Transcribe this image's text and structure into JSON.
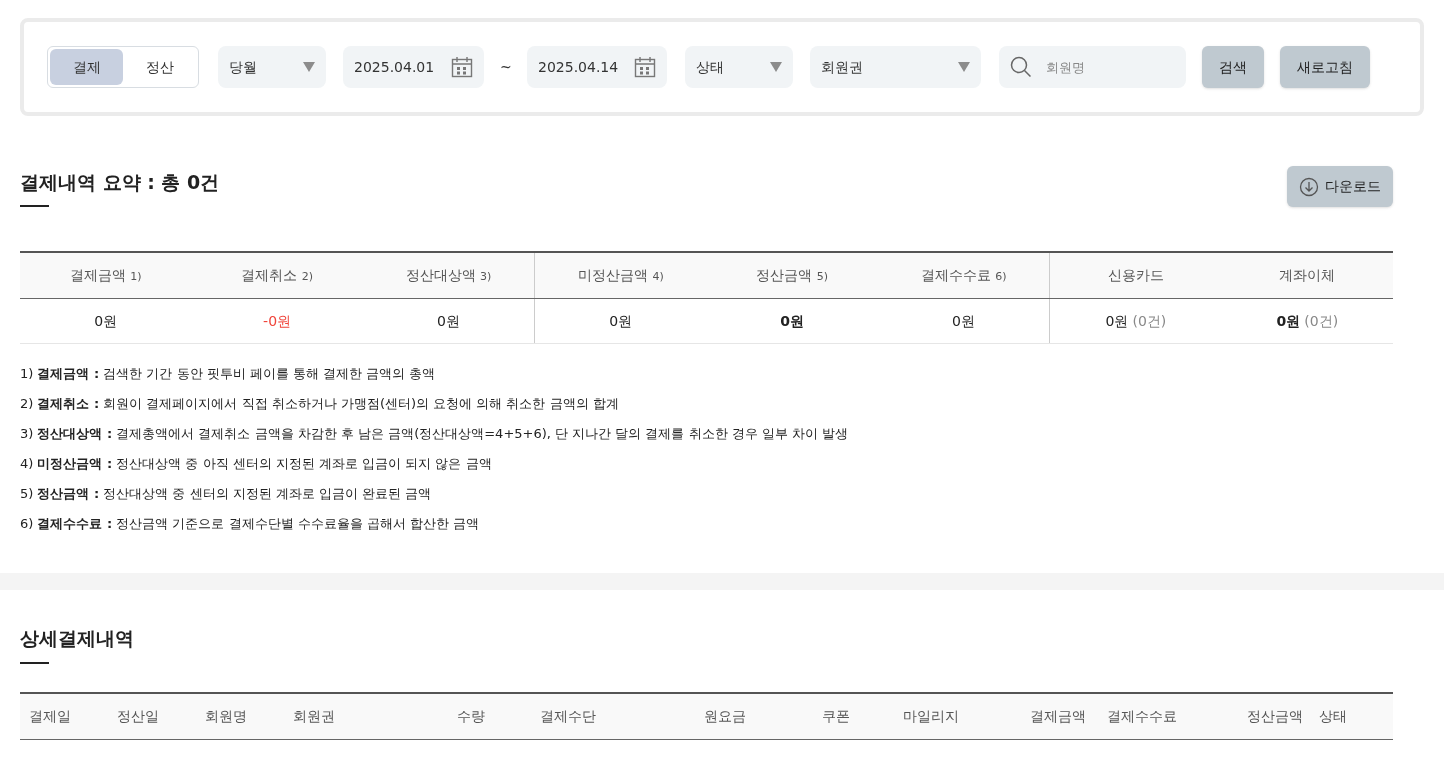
{
  "filter": {
    "mode_tabs": [
      {
        "label": "결제",
        "selected": true
      },
      {
        "label": "정산",
        "selected": false
      }
    ],
    "period_select": {
      "value": "당월"
    },
    "date_from": {
      "value": "2025.04.01"
    },
    "range_separator": "~",
    "date_to": {
      "value": "2025.04.14"
    },
    "status_select": {
      "value": "상태"
    },
    "membership_select": {
      "value": "회원권"
    },
    "search": {
      "placeholder": "회원명"
    },
    "buttons": [
      "검색",
      "새로고침"
    ]
  },
  "summary": {
    "title": "결제내역 요약 : 총 0건",
    "download_button": "다운로드",
    "columns": [
      {
        "label": "결제금액",
        "note": "1)",
        "value": "0원",
        "kind": "normal"
      },
      {
        "label": "결제취소",
        "note": "2)",
        "value": "-0원",
        "kind": "negative"
      },
      {
        "label": "정산대상액",
        "note": "3)",
        "value": "0원",
        "kind": "normal"
      },
      {
        "label": "미정산금액",
        "note": "4)",
        "value": "0원",
        "kind": "normal"
      },
      {
        "label": "정산금액",
        "note": "5)",
        "value": "0원",
        "kind": "bold"
      },
      {
        "label": "결제수수료",
        "note": "6)",
        "value": "0원",
        "kind": "normal"
      },
      {
        "label": "신용카드",
        "value": "0원",
        "count": "(0건)",
        "kind": "normal"
      },
      {
        "label": "계좌이체",
        "value": "0원",
        "count": "(0건)",
        "kind": "bold"
      }
    ],
    "notes": [
      "1) **결제금액 :** 검색한 기간 동안 핏투비 페이를 통해 결제한 금액의 총액",
      "2) **결제취소 :** 회원이 결제페이지에서 직접 취소하거나 가맹점(센터)의 요청에 의해 취소한 금액의 합계",
      "3) **정산대상액 :** 결제총액에서 결제취소 금액을 차감한 후 남은 금액(정산대상액=4+5+6), 단 지나간 달의 결제를 취소한 경우 일부 차이 발생",
      "4) **미정산금액 :** 정산대상액 중 아직 센터의 지정된 계좌로 입금이 되지 않은 금액",
      "5) **정산금액 :** 정산대상액 중 센터의 지정된 계좌로 입금이 완료된 금액",
      "6) **결제수수료 :** 정산금액 기준으로 결제수단별 수수료율을 곱해서 합산한 금액"
    ]
  },
  "detail": {
    "title": "상세결제내역",
    "columns": [
      "결제일",
      "정산일",
      "회원명",
      "회원권",
      "수량",
      "결제수단",
      "원요금",
      "쿠폰",
      "마일리지",
      "결제금액",
      "결제수수료",
      "정산금액",
      "상태"
    ]
  }
}
